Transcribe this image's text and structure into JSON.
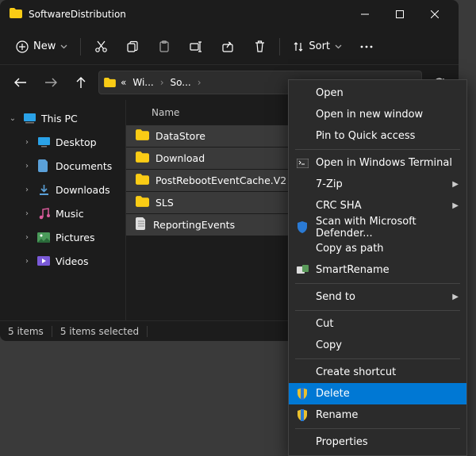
{
  "title": "SoftwareDistribution",
  "toolbar": {
    "new_label": "New",
    "sort_label": "Sort"
  },
  "breadcrumb": {
    "prefix": "«",
    "part1": "Wi...",
    "part2": "So..."
  },
  "sidebar": {
    "root": "This PC",
    "items": [
      "Desktop",
      "Documents",
      "Downloads",
      "Music",
      "Pictures",
      "Videos"
    ]
  },
  "columns": {
    "name": "Name"
  },
  "files": [
    {
      "name": "DataStore",
      "type": "folder"
    },
    {
      "name": "Download",
      "type": "folder"
    },
    {
      "name": "PostRebootEventCache.V2",
      "type": "folder"
    },
    {
      "name": "SLS",
      "type": "folder"
    },
    {
      "name": "ReportingEvents",
      "type": "file"
    }
  ],
  "status": {
    "count": "5 items",
    "selected": "5 items selected"
  },
  "context_menu": [
    {
      "label": "Open",
      "icon": null
    },
    {
      "label": "Open in new window",
      "icon": null
    },
    {
      "label": "Pin to Quick access",
      "icon": null
    },
    {
      "label": "Open in Windows Terminal",
      "icon": "terminal",
      "sep_before": true
    },
    {
      "label": "7-Zip",
      "icon": null,
      "expand": true
    },
    {
      "label": "CRC SHA",
      "icon": null,
      "expand": true
    },
    {
      "label": "Scan with Microsoft Defender...",
      "icon": "shield-blue"
    },
    {
      "label": "Copy as path",
      "icon": null
    },
    {
      "label": "SmartRename",
      "icon": "rename"
    },
    {
      "label": "Send to",
      "icon": null,
      "expand": true,
      "sep_before": true
    },
    {
      "label": "Cut",
      "icon": null,
      "sep_before": true
    },
    {
      "label": "Copy",
      "icon": null
    },
    {
      "label": "Create shortcut",
      "icon": null,
      "sep_before": true
    },
    {
      "label": "Delete",
      "icon": "shield-yellow",
      "highlighted": true
    },
    {
      "label": "Rename",
      "icon": "shield-yellow"
    },
    {
      "label": "Properties",
      "icon": null,
      "sep_before": true
    }
  ]
}
